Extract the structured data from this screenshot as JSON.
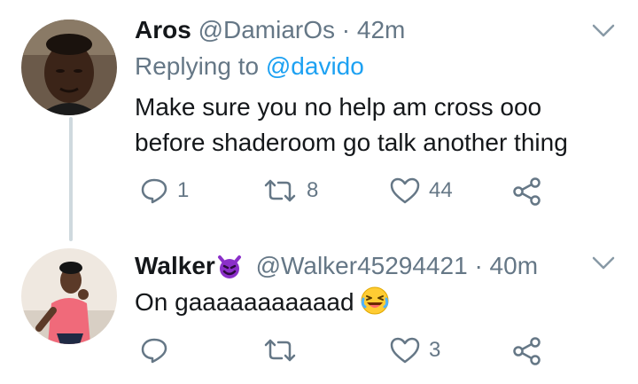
{
  "tweets": [
    {
      "name": "Aros",
      "handle": "@DamiarOs",
      "separator": "·",
      "time": "42m",
      "replying_prefix": "Replying to",
      "replying_mention": "@davido",
      "text_line1": "Make sure you no help am cross ooo",
      "text_line2": "before shaderoom go talk another thing",
      "reply_count": "1",
      "retweet_count": "8",
      "like_count": "44"
    },
    {
      "name": "Walker",
      "handle": "@Walker45294421",
      "separator": "·",
      "time": "40m",
      "text": "On gaaaaaaaaaaad",
      "reply_count": "",
      "retweet_count": "",
      "like_count": "3"
    }
  ],
  "colors": {
    "text": "#14171a",
    "secondary": "#657786",
    "link": "#1da1f2",
    "thread_line": "#cfd9de",
    "devil_emoji": "#8b2fc9"
  },
  "icons": [
    "reply-icon",
    "retweet-icon",
    "like-icon",
    "share-icon",
    "chevron-down-icon",
    "devil-emoji-icon",
    "laughing-emoji-icon"
  ]
}
